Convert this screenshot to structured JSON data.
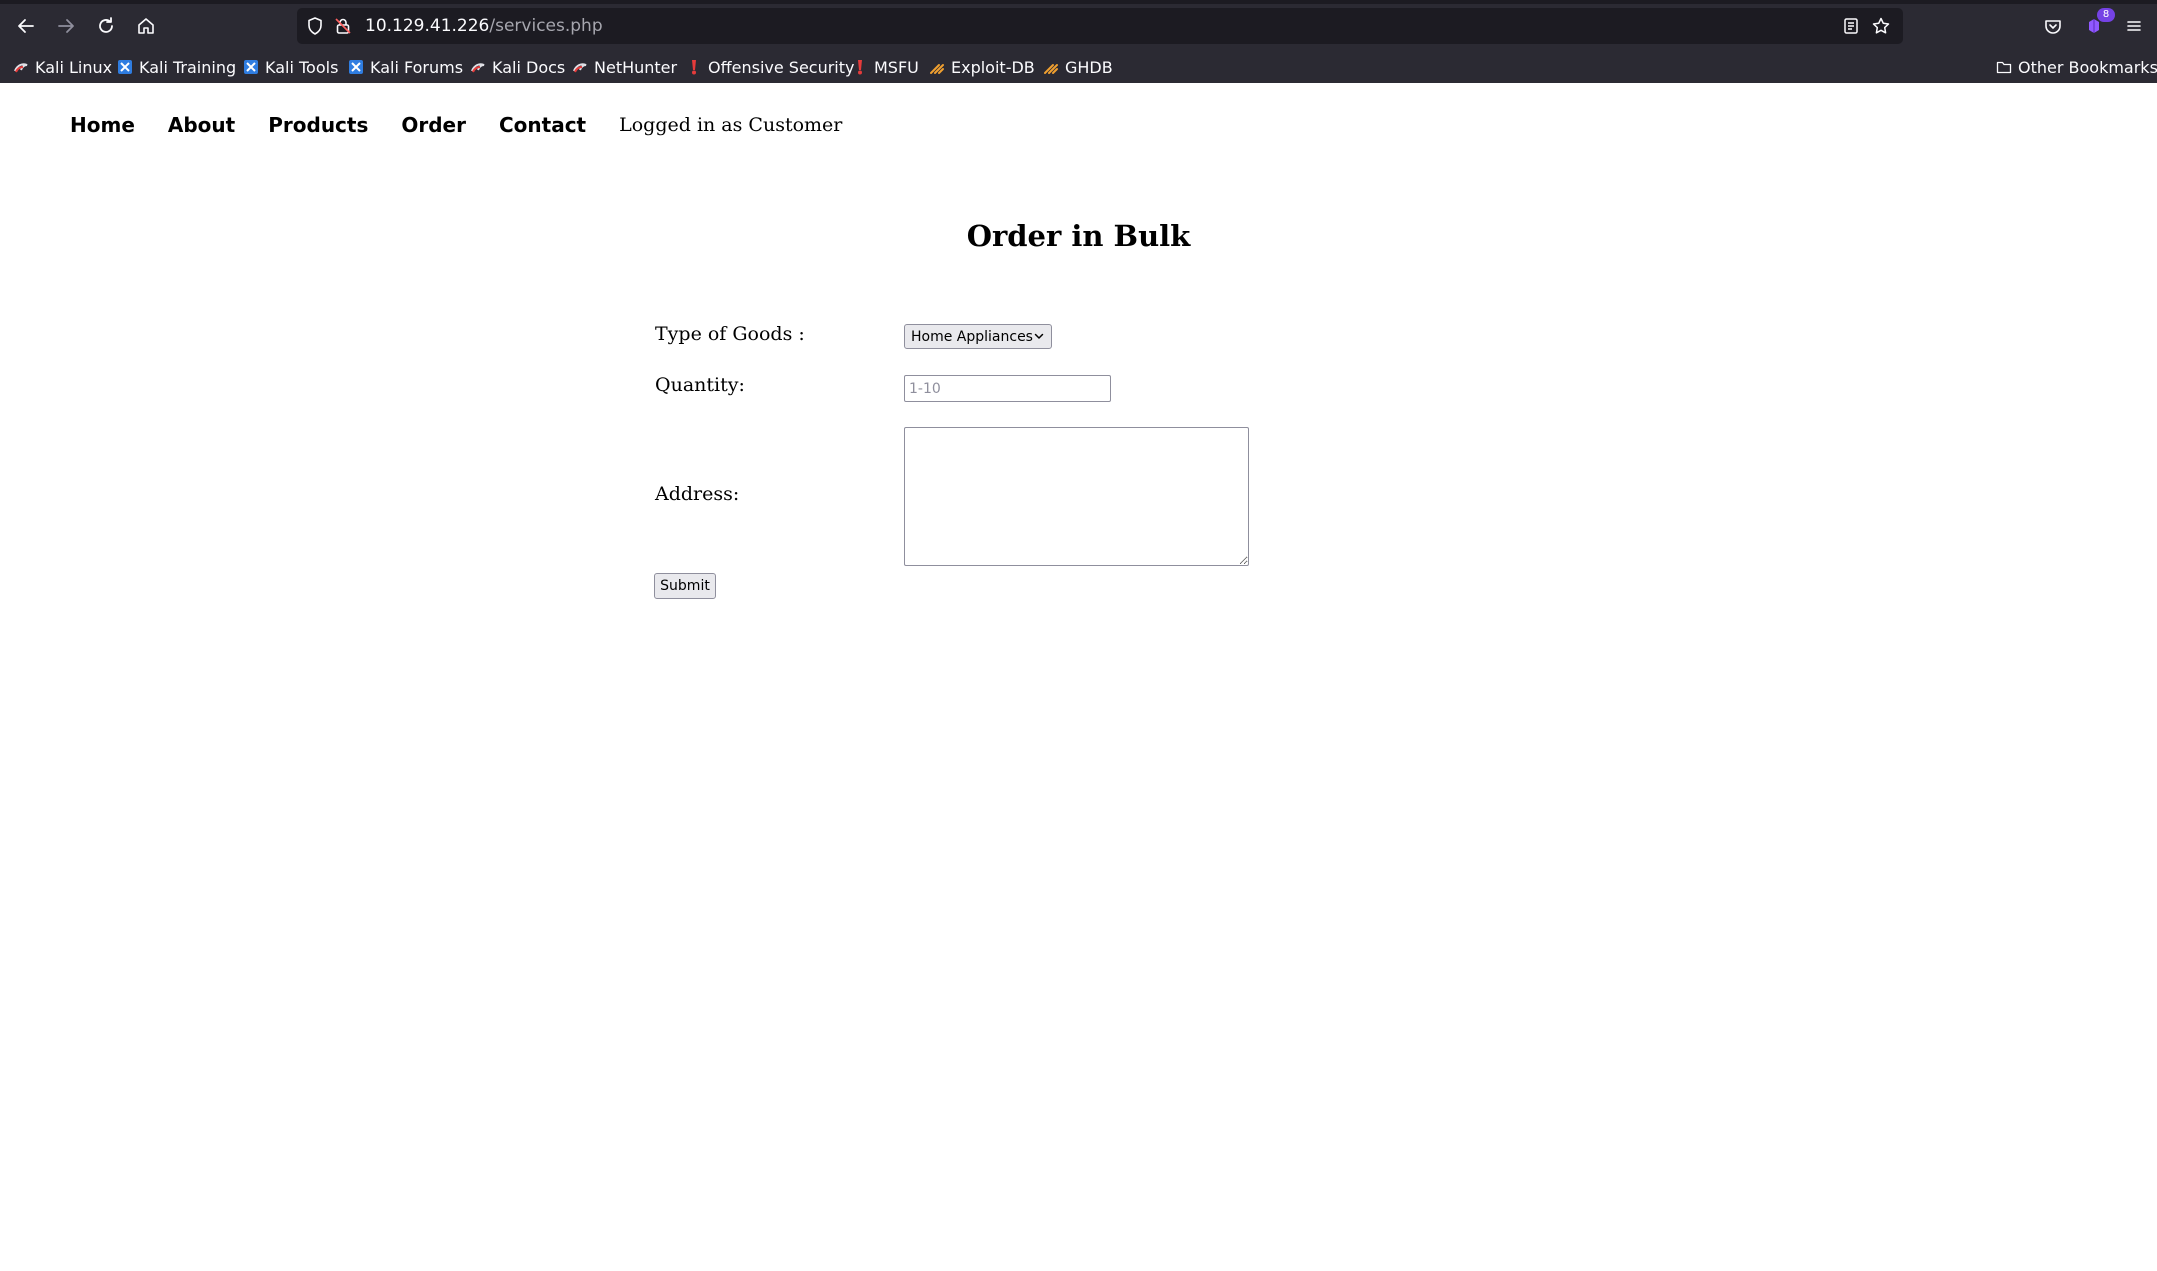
{
  "browser": {
    "url_host": "10.129.41.226",
    "url_path": "/services.php",
    "extension_badge": "8",
    "icons": [
      "back-arrow-icon",
      "forward-arrow-icon",
      "reload-icon",
      "home-icon",
      "shield-icon",
      "lock-icon",
      "reader-view-icon",
      "bookmark-star-icon",
      "pocket-icon",
      "extension-icon",
      "hamburger-menu-icon"
    ],
    "bookmarks": [
      {
        "label": "Kali Linux",
        "icon": "kali-dragon-icon"
      },
      {
        "label": "Kali Training",
        "icon": "kali-training-icon"
      },
      {
        "label": "Kali Tools",
        "icon": "kali-tools-icon"
      },
      {
        "label": "Kali Forums",
        "icon": "kali-forums-icon"
      },
      {
        "label": "Kali Docs",
        "icon": "kali-dragon-icon"
      },
      {
        "label": "NetHunter",
        "icon": "kali-dragon-icon"
      },
      {
        "label": "Offensive Security",
        "icon": "offsec-icon"
      },
      {
        "label": "MSFU",
        "icon": "offsec-icon"
      },
      {
        "label": "Exploit-DB",
        "icon": "exploit-db-icon"
      },
      {
        "label": "GHDB",
        "icon": "exploit-db-icon"
      }
    ],
    "other_bookmarks": "Other Bookmarks"
  },
  "nav": {
    "items": [
      "Home",
      "About",
      "Products",
      "Order",
      "Contact"
    ],
    "logged_in": "Logged in as Customer"
  },
  "form": {
    "title": "Order in Bulk",
    "type_label": "Type of Goods :",
    "type_value": "Home Appliances",
    "quantity_label": "Quantity:",
    "quantity_placeholder": "1-10",
    "address_label": "Address:",
    "submit_label": "Submit"
  },
  "colors": {
    "chrome_bg": "#2b2a33",
    "urlbar_bg": "#1c1b22",
    "page_bg": "#ffffff",
    "text": "#000000"
  }
}
